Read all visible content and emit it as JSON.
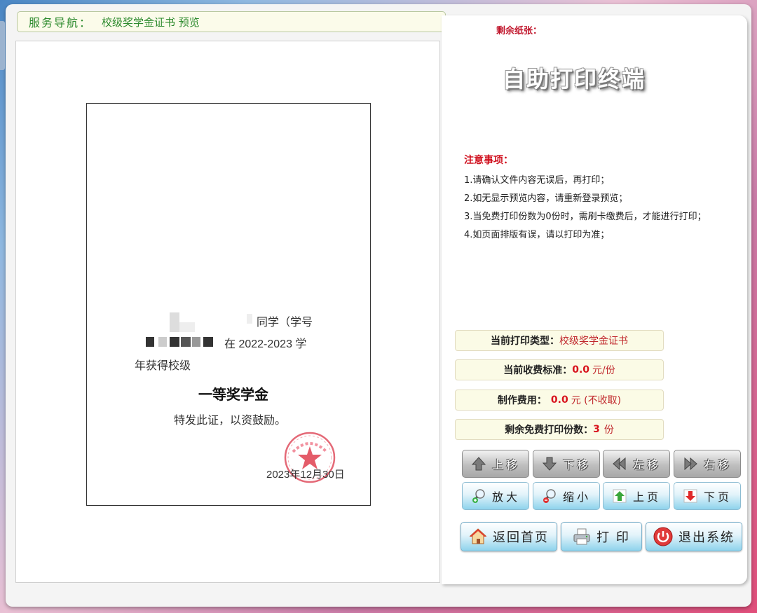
{
  "nav": {
    "label": "服务导航：",
    "value": "校级奖学金证书 预览"
  },
  "paper_left_label": "剩余纸张：",
  "kiosk_title": "自助打印终端",
  "notice": {
    "title": "注意事项：",
    "items": [
      "1.请确认文件内容无误后，再打印；",
      "2.如无显示预览内容，请重新登录预览；",
      "3.当免费打印份数为0份时，需刷卡缴费后，才能进行打印；",
      "4.如页面排版有误，请以打印为准；"
    ]
  },
  "certificate": {
    "line1": "同学（学号",
    "line2": "在 2022-2023 学",
    "line3": "年获得校级",
    "award": "一等奖学金",
    "line4": "特发此证，以资鼓励。",
    "date": "2023年12月30日"
  },
  "info": {
    "print_type_label": "当前打印类型：",
    "print_type_value": "校级奖学金证书",
    "fee_standard_label": "当前收费标准：",
    "fee_standard_value": "0.0",
    "fee_standard_unit": "元/份",
    "cost_label": "制作费用：",
    "cost_value": "0.0",
    "cost_unit": "元 (不收取)",
    "free_copies_label": "剩余免费打印份数：",
    "free_copies_value": "3",
    "free_copies_unit": "份"
  },
  "buttons": {
    "move_up": "上移",
    "move_down": "下移",
    "move_left": "左移",
    "move_right": "右移",
    "zoom_in": "放大",
    "zoom_out": "缩小",
    "prev_page": "上页",
    "next_page": "下页",
    "home": "返回首页",
    "print": "打 印",
    "exit": "退出系统"
  },
  "icons": {
    "move_up": "arrow-up-icon",
    "move_down": "arrow-down-icon",
    "move_left": "rewind-icon",
    "move_right": "fast-forward-icon",
    "zoom_in": "magnifier-plus-icon",
    "zoom_out": "magnifier-minus-icon",
    "prev_page": "green-up-arrow-icon",
    "next_page": "red-down-arrow-icon",
    "home": "house-icon",
    "print": "printer-icon",
    "exit": "power-icon"
  },
  "colors": {
    "accent_red": "#d0101e",
    "nav_green": "#2e8b2e",
    "button_blue": "#8ed3ec"
  }
}
